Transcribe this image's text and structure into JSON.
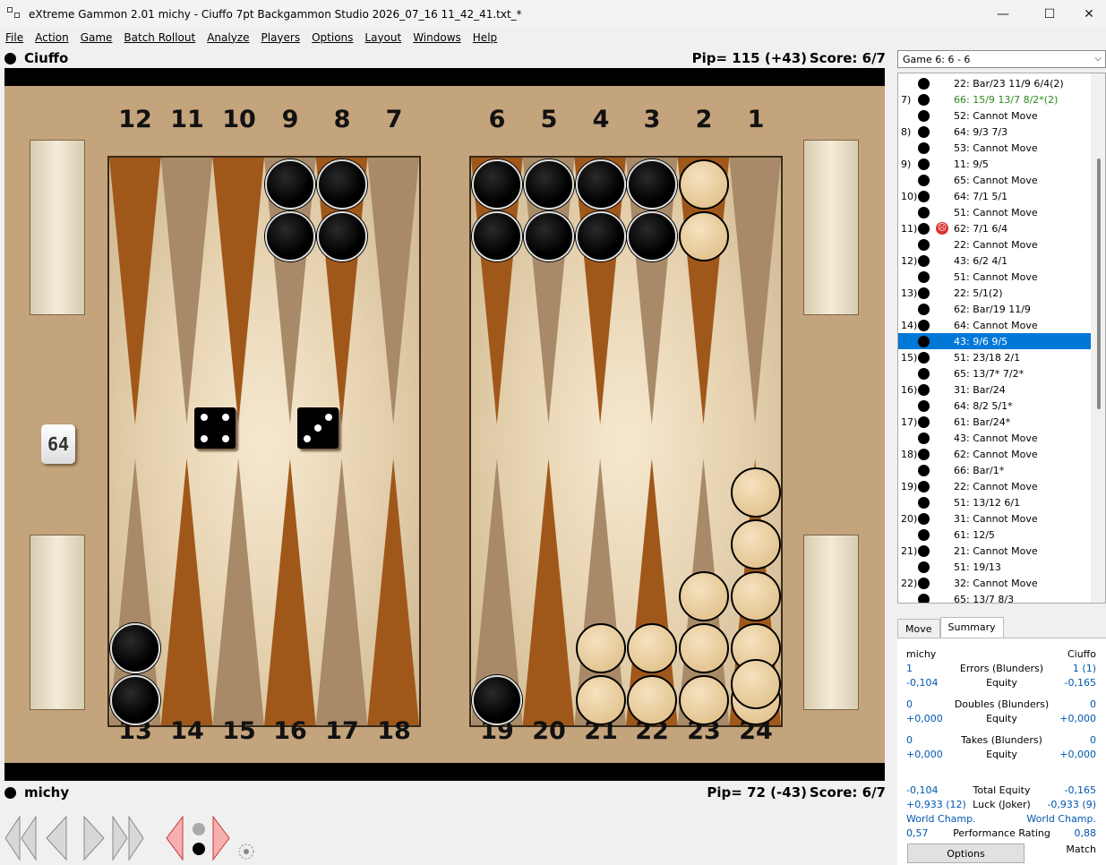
{
  "window": {
    "title": "eXtreme Gammon 2.01 michy - Ciuffo 7pt Backgammon Studio 2026_07_16 11_42_41.txt_*",
    "minimize": "—",
    "maximize": "☐",
    "close": "✕"
  },
  "menu": [
    "File",
    "Action",
    "Game",
    "Batch Rollout",
    "Analyze",
    "Players",
    "Options",
    "Layout",
    "Windows",
    "Help"
  ],
  "top_player": {
    "name": "Ciuffo",
    "pip": "Pip= 115 (+43)",
    "score": "Score: 6/7"
  },
  "bottom_player": {
    "name": "michy",
    "pip": "Pip= 72 (-43)",
    "score": "Score: 6/7"
  },
  "board": {
    "top_numbers": [
      "12",
      "11",
      "10",
      "9",
      "8",
      "7",
      "6",
      "5",
      "4",
      "3",
      "2",
      "1"
    ],
    "bottom_numbers": [
      "13",
      "14",
      "15",
      "16",
      "17",
      "18",
      "19",
      "20",
      "21",
      "22",
      "23",
      "24"
    ],
    "cube": "64",
    "dice": [
      4,
      3
    ],
    "colors": {
      "dark_point": "#a0581a",
      "light_point": "#a88a68",
      "wood": "#c4a47c"
    }
  },
  "game_select": "Game 6: 6 - 6",
  "moves": [
    {
      "num": "",
      "text": "22: Bar/23 11/9 6/4(2)",
      "style": ""
    },
    {
      "num": "7)",
      "text": "66: 15/9 13/7 8/2*(2)",
      "style": "green"
    },
    {
      "num": "",
      "text": "52: Cannot Move",
      "style": ""
    },
    {
      "num": "8)",
      "text": "64: 9/3 7/3",
      "style": ""
    },
    {
      "num": "",
      "text": "53: Cannot Move",
      "style": ""
    },
    {
      "num": "9)",
      "text": "11: 9/5",
      "style": ""
    },
    {
      "num": "",
      "text": "65: Cannot Move",
      "style": ""
    },
    {
      "num": "10)",
      "text": "64: 7/1 5/1",
      "style": ""
    },
    {
      "num": "",
      "text": "51: Cannot Move",
      "style": ""
    },
    {
      "num": "11)",
      "text": "62: 7/1 6/4",
      "style": "sad"
    },
    {
      "num": "",
      "text": "22: Cannot Move",
      "style": ""
    },
    {
      "num": "12)",
      "text": "43: 6/2 4/1",
      "style": ""
    },
    {
      "num": "",
      "text": "51: Cannot Move",
      "style": ""
    },
    {
      "num": "13)",
      "text": "22: 5/1(2)",
      "style": ""
    },
    {
      "num": "",
      "text": "62: Bar/19 11/9",
      "style": ""
    },
    {
      "num": "14)",
      "text": "64: Cannot Move",
      "style": ""
    },
    {
      "num": "",
      "text": "43: 9/6 9/5",
      "style": "sel"
    },
    {
      "num": "15)",
      "text": "51: 23/18 2/1",
      "style": ""
    },
    {
      "num": "",
      "text": "65: 13/7* 7/2*",
      "style": ""
    },
    {
      "num": "16)",
      "text": "31: Bar/24",
      "style": ""
    },
    {
      "num": "",
      "text": "64: 8/2 5/1*",
      "style": ""
    },
    {
      "num": "17)",
      "text": "61: Bar/24*",
      "style": ""
    },
    {
      "num": "",
      "text": "43: Cannot Move",
      "style": ""
    },
    {
      "num": "18)",
      "text": "62: Cannot Move",
      "style": ""
    },
    {
      "num": "",
      "text": "66: Bar/1*",
      "style": ""
    },
    {
      "num": "19)",
      "text": "22: Cannot Move",
      "style": ""
    },
    {
      "num": "",
      "text": "51: 13/12 6/1",
      "style": ""
    },
    {
      "num": "20)",
      "text": "31: Cannot Move",
      "style": ""
    },
    {
      "num": "",
      "text": "61: 12/5",
      "style": ""
    },
    {
      "num": "21)",
      "text": "21: Cannot Move",
      "style": ""
    },
    {
      "num": "",
      "text": "51: 19/13",
      "style": ""
    },
    {
      "num": "22)",
      "text": "32: Cannot Move",
      "style": ""
    },
    {
      "num": "",
      "text": "65: 13/7 8/3",
      "style": ""
    }
  ],
  "tabs": [
    "Move",
    "Summary"
  ],
  "summary": {
    "header": {
      "left": "michy",
      "right": "Ciuffo"
    },
    "rows": [
      {
        "l": "1",
        "c": "Errors (Blunders)",
        "r": "1 (1)"
      },
      {
        "l": "-0,104",
        "c": "Equity",
        "r": "-0,165"
      },
      {
        "l": "0",
        "c": "Doubles (Blunders)",
        "r": "0"
      },
      {
        "l": "+0,000",
        "c": "Equity",
        "r": "+0,000"
      },
      {
        "l": "0",
        "c": "Takes (Blunders)",
        "r": "0"
      },
      {
        "l": "+0,000",
        "c": "Equity",
        "r": "+0,000"
      },
      {
        "l": "-0,104",
        "c": "Total Equity",
        "r": "-0,165"
      },
      {
        "l": "+0,933 (12)",
        "c": "Luck (Joker)",
        "r": "-0,933 (9)"
      },
      {
        "l": "World Champ.",
        "c": "",
        "r": "World Champ."
      },
      {
        "l": "0,57",
        "c": "Performance Rating",
        "r": "0,88"
      }
    ],
    "options_button": "Options",
    "match_label": "Match"
  }
}
